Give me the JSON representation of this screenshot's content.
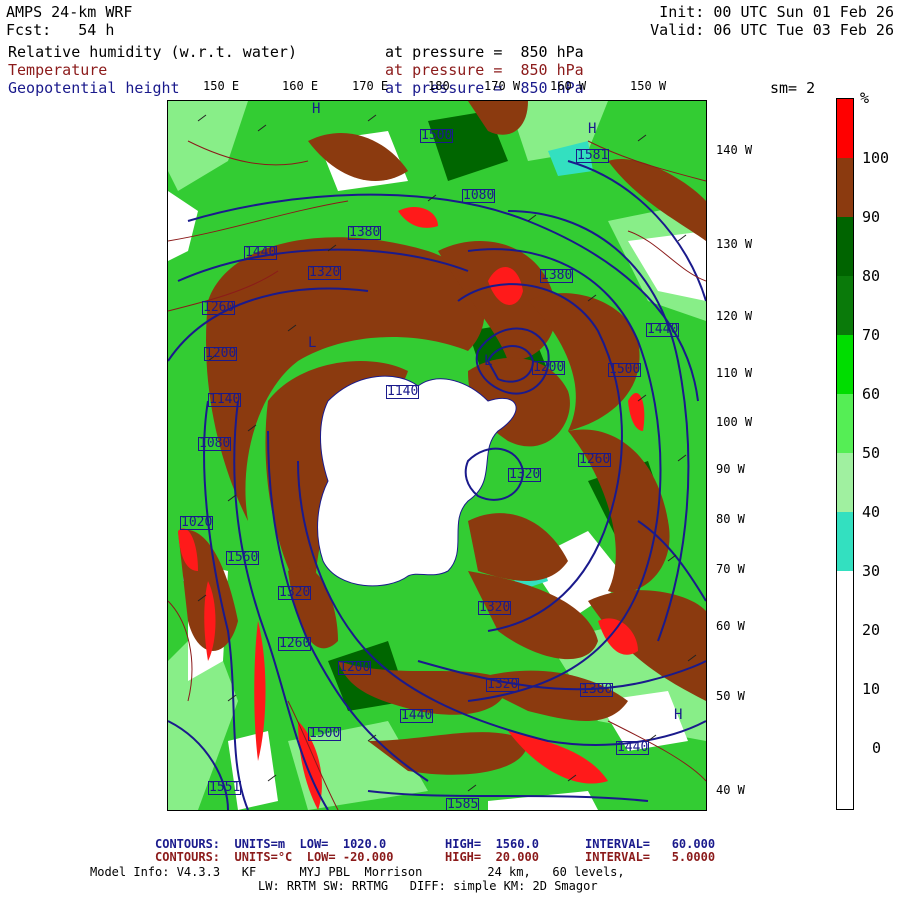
{
  "header": {
    "model": "AMPS 24-km WRF",
    "fcst": "Fcst:   54 h",
    "init": "Init: 00 UTC Sun 01 Feb 26",
    "valid": "Valid: 06 UTC Tue 03 Feb 26",
    "field1": "Relative humidity (w.r.t. water)",
    "field2": "Temperature",
    "field3": "Geopotential height",
    "pressure1": "at pressure =  850 hPa",
    "pressure2": "at pressure =  850 hPa",
    "pressure3": "at pressure =  850 hPa",
    "smoothing": "sm= 2"
  },
  "map": {
    "lon_labels": [
      "150 E",
      "160 E",
      "170 E",
      "180",
      "170 W",
      "160 W",
      "150 W"
    ],
    "lat_labels": [
      "140 W",
      "130 W",
      "120 W",
      "110 W",
      "100 W",
      "90 W",
      "80 W",
      "70 W",
      "60 W",
      "50 W",
      "40 W"
    ],
    "height_labels": [
      "1500",
      "1581",
      "1440",
      "1380",
      "1320",
      "1260",
      "1200",
      "1140",
      "1080",
      "1020",
      "1560",
      "1320",
      "1260",
      "1200",
      "1140",
      "1080",
      "1440",
      "1500",
      "1380",
      "1320",
      "1200",
      "1260",
      "1440",
      "1320",
      "1440",
      "1500",
      "1551",
      "1585",
      "1320",
      "1380"
    ],
    "high_markers": [
      "H",
      "H",
      "H",
      "L",
      "L"
    ],
    "colors": {
      "rh_100": "#ff0000",
      "rh_90": "#8b3a0f",
      "rh_80": "#006400",
      "rh_70": "#007a00",
      "rh_60": "#00dd00",
      "rh_50": "#55ee55",
      "rh_40": "#a0f0a0",
      "rh_30": "#33e0c0",
      "height_contour": "#1a1a8c",
      "temp_contour": "#8b1a1a"
    }
  },
  "colorbar": {
    "unit": "%",
    "labels": [
      "100",
      "90",
      "80",
      "70",
      "60",
      "50",
      "40",
      "30",
      "20",
      "10",
      "0"
    ],
    "colors": [
      "#ff0000",
      "#8b3a0f",
      "#006400",
      "#0a7a0a",
      "#00dd00",
      "#55ee55",
      "#a0f0a0",
      "#33e0c0",
      "#ffffff",
      "#ffffff",
      "#ffffff",
      "#ffffff"
    ]
  },
  "footer": {
    "line1_a": "CONTOURS:  UNITS=m  LOW=  1020.0",
    "line1_b": "HIGH=  1560.0",
    "line1_c": "INTERVAL=   60.000",
    "line2_a": "CONTOURS:  UNITS=°C  LOW= -20.000",
    "line2_b": "HIGH=  20.000",
    "line2_c": "INTERVAL=   5.0000",
    "line3": "Model Info: V4.3.3   KF      MYJ PBL  Morrison         24 km,   60 levels,",
    "line4": "LW: RRTM SW: RRTMG   DIFF: simple KM: 2D Smagor"
  }
}
